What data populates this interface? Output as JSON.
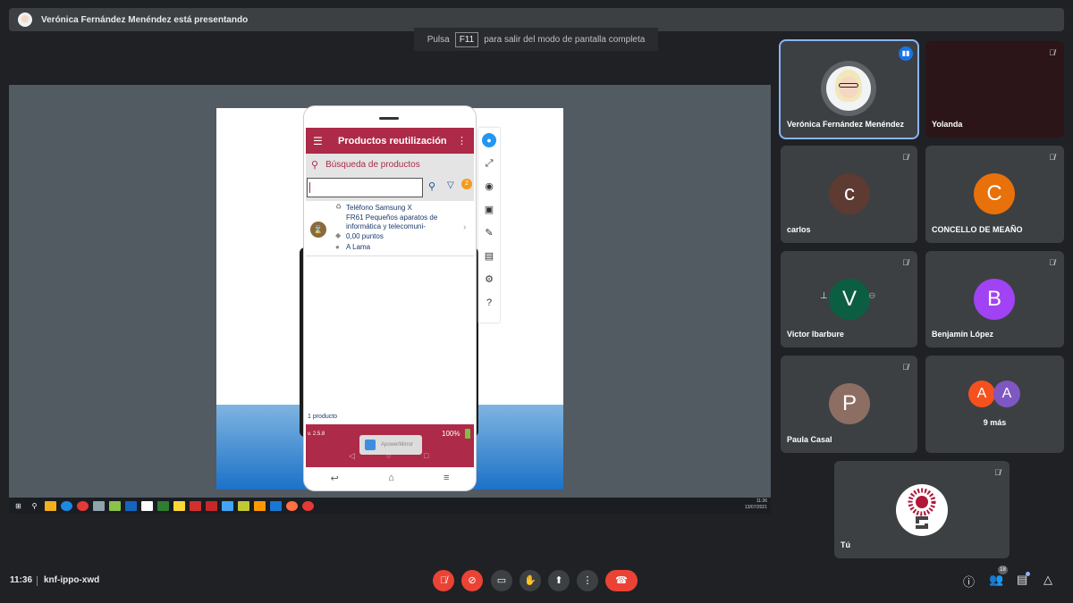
{
  "banner": {
    "text": "Verónica Fernández Menéndez está presentando"
  },
  "f11": {
    "pre": "Pulsa",
    "key": "F11",
    "post": "para salir del modo de pantalla completa"
  },
  "app": {
    "title": "Productos reutilización",
    "search_title": "Búsqueda de productos",
    "filter_badge": "2",
    "item": {
      "line1": "Teléfono Samsung X",
      "line2": "FR61 Pequeños aparatos de",
      "line3": "informática y telecomuni-",
      "line4": "0,00 puntos",
      "line5": "A Lama"
    },
    "count": "1 producto",
    "version": "v. 2.5.8",
    "battery": "100%",
    "mirror_label": "ApowerMirror"
  },
  "taskbar": {
    "time": "11:36",
    "date": "13/07/2021"
  },
  "participants": [
    {
      "name": "Verónica Fernández Menéndez"
    },
    {
      "name": "Yolanda"
    },
    {
      "name": "carlos",
      "initial": "c",
      "color": "#5d3a32"
    },
    {
      "name": "CONCELLO DE MEAÑO",
      "initial": "C",
      "color": "#e8710a"
    },
    {
      "name": "Victor Ibarbure",
      "initial": "V",
      "color": "#0b5e42"
    },
    {
      "name": "Benjamín López",
      "initial": "B",
      "color": "#a142f4"
    },
    {
      "name": "Paula Casal",
      "initial": "P",
      "color": "#8d6e63"
    },
    {
      "name": "9 más",
      "initial_a": "A",
      "color_a": "#f4511e",
      "initial_b": "A",
      "color_b": "#7e57c2"
    },
    {
      "name": "Tú"
    }
  ],
  "meeting": {
    "time": "11:36",
    "code": "knf-ippo-xwd",
    "participant_count": "18"
  },
  "colors": {
    "accent": "#ad2a48",
    "hangup": "#ea4335",
    "active_border": "#8ab4f8"
  }
}
